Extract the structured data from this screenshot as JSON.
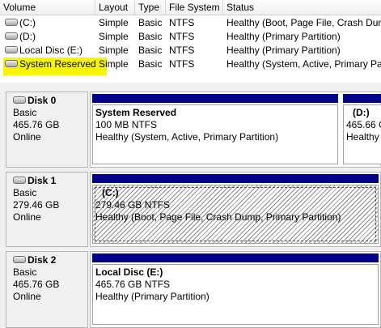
{
  "volume_list": {
    "columns": [
      "Volume",
      "Layout",
      "Type",
      "File System",
      "Status"
    ],
    "rows": [
      {
        "volume": "(C:)",
        "layout": "Simple",
        "type": "Basic",
        "fs": "NTFS",
        "status": "Healthy (Boot, Page File, Crash Dump"
      },
      {
        "volume": "(D:)",
        "layout": "Simple",
        "type": "Basic",
        "fs": "NTFS",
        "status": "Healthy (Primary Partition)"
      },
      {
        "volume": "Local Disc (E:)",
        "layout": "Simple",
        "type": "Basic",
        "fs": "NTFS",
        "status": "Healthy (Primary Partition)"
      },
      {
        "volume": "System Reserved",
        "layout": "Simple",
        "type": "Basic",
        "fs": "NTFS",
        "status": "Healthy (System, Active, Primary Par"
      }
    ],
    "highlight_color": "#f6f600"
  },
  "disks": [
    {
      "name": "Disk 0",
      "type": "Basic",
      "size": "465.76 GB",
      "state": "Online",
      "partitions": [
        {
          "name": "System Reserved",
          "size": "100 MB NTFS",
          "status": "Healthy (System, Active, Primary Partition)"
        },
        {
          "name": "(D:)",
          "size": "465.66 G",
          "status": "Healthy"
        }
      ]
    },
    {
      "name": "Disk 1",
      "type": "Basic",
      "size": "279.46 GB",
      "state": "Online",
      "partitions": [
        {
          "name": "(C:)",
          "size": "279.46 GB NTFS",
          "status": "Healthy (Boot, Page File, Crash Dump, Primary Partition)"
        }
      ]
    },
    {
      "name": "Disk 2",
      "type": "Basic",
      "size": "465.76 GB",
      "state": "Online",
      "partitions": [
        {
          "name": "Local Disc  (E:)",
          "size": "465.76 GB NTFS",
          "status": "Healthy (Primary Partition)"
        }
      ]
    }
  ],
  "colors": {
    "partition_bar": "#00008b",
    "map_background": "#f0f0f0"
  },
  "icons": {
    "drive": "drive-icon"
  }
}
